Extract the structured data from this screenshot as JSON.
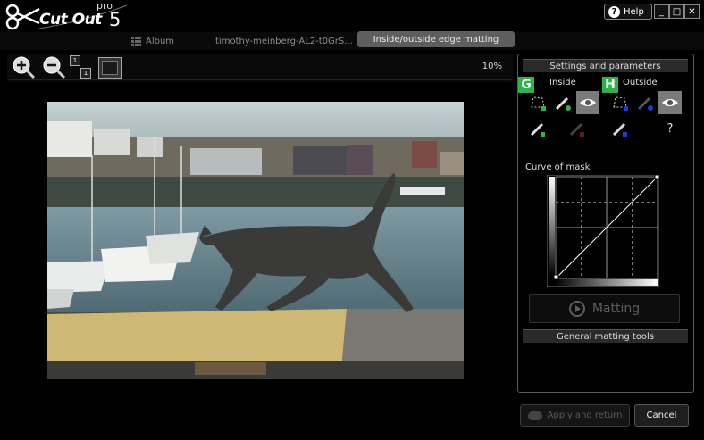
{
  "app": {
    "logo_text": "Cut Out",
    "logo_pro": "pro",
    "logo_version": "5"
  },
  "window": {
    "help_label": "Help",
    "minimize": "_",
    "maximize": "□",
    "close": "✕"
  },
  "tabs": [
    {
      "label": "Album"
    },
    {
      "label": "timothy-meinberg-AL2-t0GrS..."
    },
    {
      "label": "Inside/outside edge matting",
      "active": true
    }
  ],
  "toolbar": {
    "zoom_in": "zoom-in",
    "zoom_out": "zoom-out",
    "actual_size_top": "1",
    "actual_size_bottom": "1",
    "zoom_percent": "10%"
  },
  "panel": {
    "title": "Settings and parameters",
    "inside": {
      "badge": "G",
      "label": "Inside"
    },
    "outside": {
      "badge": "H",
      "label": "Outside"
    },
    "help_mark": "?",
    "curve_title": "Curve of mask",
    "matting_label": "Matting",
    "general_title": "General matting tools"
  },
  "footer": {
    "apply_label": "Apply and return",
    "cancel_label": "Cancel"
  },
  "colors": {
    "badge": "#2db34a",
    "selected_tool": "#7a7a7a",
    "panel_border": "#5a5a5a"
  }
}
